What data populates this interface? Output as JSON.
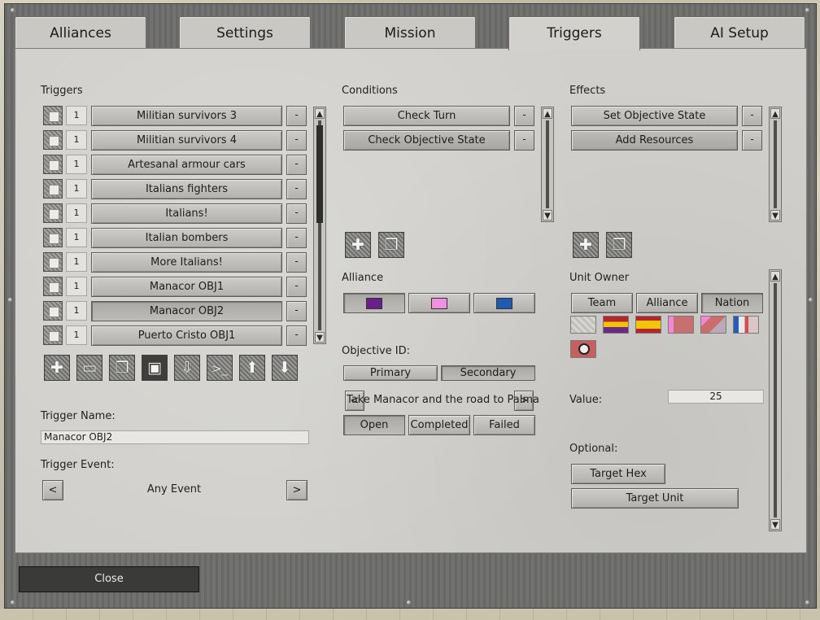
{
  "tabs": [
    {
      "label": "Alliances"
    },
    {
      "label": "Settings"
    },
    {
      "label": "Mission"
    },
    {
      "label": "Triggers"
    },
    {
      "label": "AI Setup"
    }
  ],
  "triggers": {
    "heading": "Triggers",
    "items": [
      {
        "count": "1",
        "name": "Militian survivors 3"
      },
      {
        "count": "1",
        "name": "Militian survivors 4"
      },
      {
        "count": "1",
        "name": "Artesanal armour cars"
      },
      {
        "count": "1",
        "name": "Italians fighters"
      },
      {
        "count": "1",
        "name": "Italians!"
      },
      {
        "count": "1",
        "name": "Italian bombers"
      },
      {
        "count": "1",
        "name": "More Italians!"
      },
      {
        "count": "1",
        "name": "Manacor OBJ1"
      },
      {
        "count": "1",
        "name": "Manacor OBJ2"
      },
      {
        "count": "1",
        "name": "Puerto Cristo OBJ1"
      }
    ],
    "remove_label": "-",
    "toolbar_icons": [
      "plus-icon",
      "folder-icon",
      "copy-icon",
      "save-icon",
      "import-icon",
      "console-icon",
      "arrow-up-icon",
      "arrow-down-icon"
    ],
    "name_label": "Trigger Name:",
    "name_value": "Manacor OBJ2",
    "event_label": "Trigger Event:",
    "event_value": "Any Event",
    "event_prev": "<",
    "event_next": ">"
  },
  "conditions": {
    "heading": "Conditions",
    "items": [
      {
        "name": "Check Turn"
      },
      {
        "name": "Check Objective State"
      }
    ],
    "alliance_label": "Alliance",
    "alliance_colors": [
      "#6a1f8c",
      "#f28fe0",
      "#1e5bb0"
    ],
    "objective_label": "Objective ID:",
    "objective_types": [
      "Primary",
      "Secondary"
    ],
    "objective_name": "Take Manacor and the road to Palma",
    "objective_prev": "<",
    "objective_next": ">",
    "states": [
      "Open",
      "Completed",
      "Failed"
    ]
  },
  "effects": {
    "heading": "Effects",
    "items": [
      {
        "name": "Set Objective State"
      },
      {
        "name": "Add Resources"
      }
    ],
    "unit_owner_label": "Unit Owner",
    "owner_tabs": [
      "Team",
      "Alliance",
      "Nation"
    ],
    "value_label": "Value:",
    "value": "25",
    "optional_label": "Optional:",
    "target_hex": "Target Hex",
    "target_unit": "Target Unit"
  },
  "footer": {
    "close_label": "Close"
  }
}
